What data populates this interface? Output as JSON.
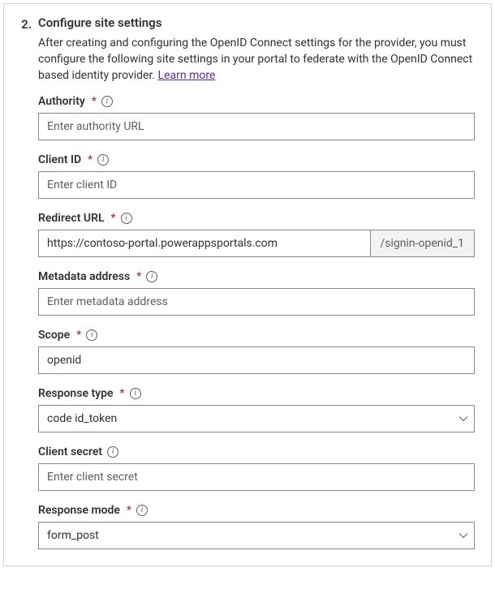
{
  "step": {
    "number": "2.",
    "title": "Configure site settings",
    "description": "After creating and configuring the OpenID Connect settings for the provider, you must configure the following site settings in your portal to federate with the OpenID Connect based identity provider.",
    "learn_more": "Learn more"
  },
  "fields": {
    "authority": {
      "label": "Authority",
      "required": true,
      "placeholder": "Enter authority URL",
      "value": ""
    },
    "client_id": {
      "label": "Client ID",
      "required": true,
      "placeholder": "Enter client ID",
      "value": ""
    },
    "redirect_url": {
      "label": "Redirect URL",
      "required": true,
      "value": "https://contoso-portal.powerappsportals.com",
      "suffix": "/signin-openid_1"
    },
    "metadata_address": {
      "label": "Metadata address",
      "required": true,
      "placeholder": "Enter metadata address",
      "value": ""
    },
    "scope": {
      "label": "Scope",
      "required": true,
      "value": "openid"
    },
    "response_type": {
      "label": "Response type",
      "required": true,
      "value": "code id_token"
    },
    "client_secret": {
      "label": "Client secret",
      "required": false,
      "placeholder": "Enter client secret",
      "value": ""
    },
    "response_mode": {
      "label": "Response mode",
      "required": true,
      "value": "form_post"
    }
  }
}
